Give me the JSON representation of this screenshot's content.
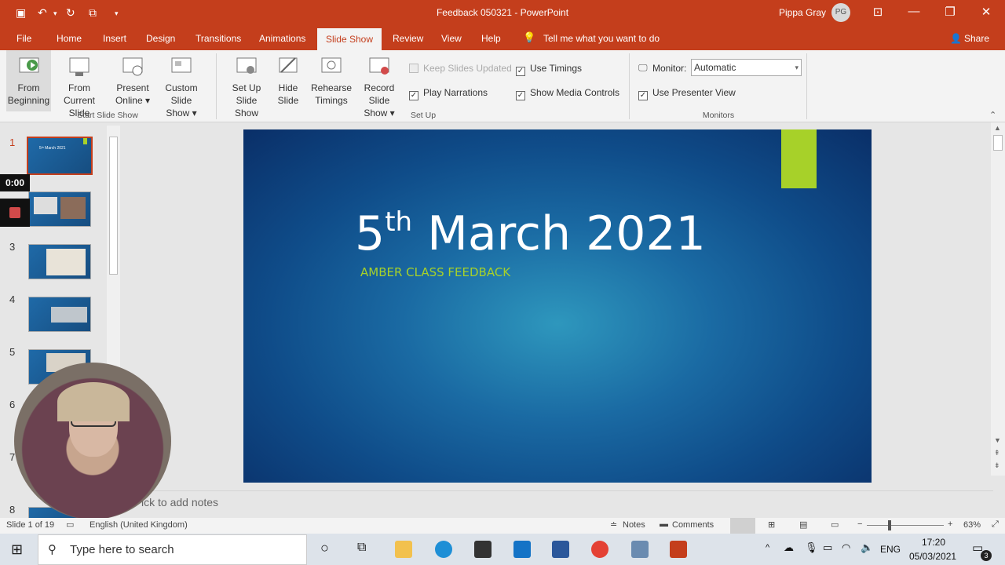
{
  "window": {
    "doc_title": "Feedback 050321  -  PowerPoint",
    "user_name": "Pippa Gray",
    "user_initials": "PG"
  },
  "tabs": {
    "file": "File",
    "home": "Home",
    "insert": "Insert",
    "design": "Design",
    "transitions": "Transitions",
    "animations": "Animations",
    "slideshow": "Slide Show",
    "review": "Review",
    "view": "View",
    "help": "Help",
    "tellme": "Tell me what you want to do",
    "share": "Share"
  },
  "ribbon": {
    "from_beginning_1": "From",
    "from_beginning_2": "Beginning",
    "from_current_1": "From",
    "from_current_2": "Current Slide",
    "present_online_1": "Present",
    "present_online_2": "Online ▾",
    "custom_show_1": "Custom Slide",
    "custom_show_2": "Show ▾",
    "group_start": "Start Slide Show",
    "setup_show_1": "Set Up",
    "setup_show_2": "Slide Show",
    "hide_slide_1": "Hide",
    "hide_slide_2": "Slide",
    "rehearse_1": "Rehearse",
    "rehearse_2": "Timings",
    "record_1": "Record Slide",
    "record_2": "Show ▾",
    "keep_updated": "Keep Slides Updated",
    "play_narrations": "Play Narrations",
    "use_timings": "Use Timings",
    "show_media": "Show Media Controls",
    "group_setup": "Set Up",
    "monitor_label": "Monitor:",
    "monitor_value": "Automatic",
    "presenter_view": "Use Presenter View",
    "group_monitors": "Monitors"
  },
  "thumbnails": {
    "n1": "1",
    "n3": "3",
    "n4": "4",
    "n5": "5",
    "n6": "6",
    "n7": "7",
    "n8": "8"
  },
  "recorder": {
    "timer": "0:00"
  },
  "slide": {
    "title_main": "5",
    "title_sup": "th",
    "title_rest": " March 2021",
    "subtitle": "AMBER CLASS FEEDBACK"
  },
  "notes": {
    "placeholder": "ick to add notes"
  },
  "status": {
    "slide_count": "Slide 1 of 19",
    "language": "English (United Kingdom)",
    "notes": "Notes",
    "comments": "Comments",
    "zoom": "63%"
  },
  "taskbar": {
    "search_placeholder": "Type here to search",
    "lang": "ENG",
    "time": "17:20",
    "date": "05/03/2021",
    "notif_count": "3"
  },
  "colors": {
    "accent": "#c43e1c",
    "slide_green": "#a7d129"
  }
}
